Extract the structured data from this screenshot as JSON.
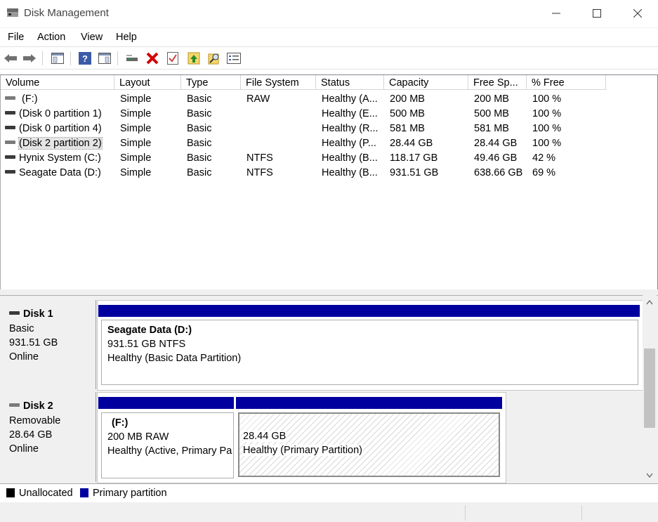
{
  "window": {
    "title": "Disk Management"
  },
  "menu": {
    "file": "File",
    "action": "Action",
    "view": "View",
    "help": "Help"
  },
  "toolbar": {
    "icons": [
      "back-arrow-icon",
      "forward-arrow-icon",
      "console-tree-icon",
      "help-icon",
      "show-pane-icon",
      "connect-disk-icon",
      "delete-icon",
      "properties-icon",
      "up-icon",
      "find-icon",
      "list-view-icon"
    ]
  },
  "volume_list": {
    "columns": [
      "Volume",
      "Layout",
      "Type",
      "File System",
      "Status",
      "Capacity",
      "Free Sp...",
      "% Free"
    ],
    "rows": [
      {
        "volume": "(F:)",
        "layout": "Simple",
        "type": "Basic",
        "fs": "RAW",
        "status": "Healthy (A...",
        "capacity": "200 MB",
        "free": "200 MB",
        "pct": "100 %"
      },
      {
        "volume": "(Disk 0 partition 1)",
        "layout": "Simple",
        "type": "Basic",
        "fs": "",
        "status": "Healthy (E...",
        "capacity": "500 MB",
        "free": "500 MB",
        "pct": "100 %"
      },
      {
        "volume": "(Disk 0 partition 4)",
        "layout": "Simple",
        "type": "Basic",
        "fs": "",
        "status": "Healthy (R...",
        "capacity": "581 MB",
        "free": "581 MB",
        "pct": "100 %"
      },
      {
        "volume": "(Disk 2 partition 2)",
        "layout": "Simple",
        "type": "Basic",
        "fs": "",
        "status": "Healthy (P...",
        "capacity": "28.44 GB",
        "free": "28.44 GB",
        "pct": "100 %"
      },
      {
        "volume": "Hynix System (C:)",
        "layout": "Simple",
        "type": "Basic",
        "fs": "NTFS",
        "status": "Healthy (B...",
        "capacity": "118.17 GB",
        "free": "49.46 GB",
        "pct": "42 %"
      },
      {
        "volume": "Seagate Data (D:)",
        "layout": "Simple",
        "type": "Basic",
        "fs": "NTFS",
        "status": "Healthy (B...",
        "capacity": "931.51 GB",
        "free": "638.66 GB",
        "pct": "69 %"
      }
    ]
  },
  "disks": {
    "disk1": {
      "name": "Disk 1",
      "type": "Basic",
      "size": "931.51 GB",
      "state": "Online",
      "partition": {
        "name": "Seagate Data  (D:)",
        "size_fs": "931.51 GB NTFS",
        "status": "Healthy (Basic Data Partition)"
      }
    },
    "disk2": {
      "name": "Disk 2",
      "type": "Removable",
      "size": "28.64 GB",
      "state": "Online",
      "partition1": {
        "name": "(F:)",
        "size_fs": "200 MB RAW",
        "status": "Healthy (Active, Primary Pa"
      },
      "partition2": {
        "size": "28.44 GB",
        "status": "Healthy (Primary Partition)"
      }
    }
  },
  "legend": {
    "unallocated": "Unallocated",
    "primary": "Primary partition"
  },
  "colors": {
    "primary_partition": "#00009f",
    "unallocated": "#000000"
  }
}
